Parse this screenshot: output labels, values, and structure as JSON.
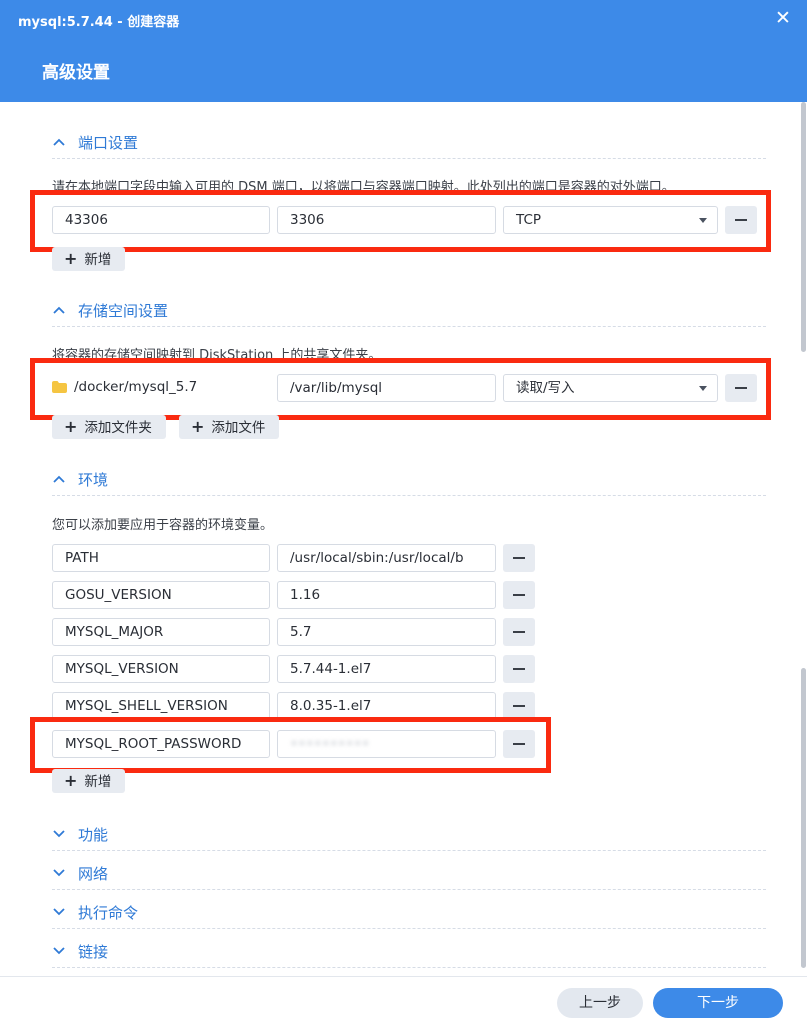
{
  "window": {
    "title": "mysql:5.7.44 - 创建容器",
    "page_title": "高级设置"
  },
  "sections": {
    "ports": {
      "title": "端口设置",
      "expanded": true,
      "description": "请在本地端口字段中输入可用的 DSM 端口，以将端口与容器端口映射。此处列出的端口是容器的对外端口。",
      "row": {
        "local_port": "43306",
        "container_port": "3306",
        "protocol": "TCP"
      },
      "add_label": "新增"
    },
    "storage": {
      "title": "存储空间设置",
      "expanded": true,
      "description": "将容器的存储空间映射到 DiskStation 上的共享文件夹。",
      "row": {
        "folder": "/docker/mysql_5.7",
        "mount_path": "/var/lib/mysql",
        "permission": "读取/写入"
      },
      "add_folder_label": "添加文件夹",
      "add_file_label": "添加文件"
    },
    "environment": {
      "title": "环境",
      "expanded": true,
      "description": "您可以添加要应用于容器的环境变量。",
      "rows": [
        {
          "key": "PATH",
          "value": "/usr/local/sbin:/usr/local/b"
        },
        {
          "key": "GOSU_VERSION",
          "value": "1.16"
        },
        {
          "key": "MYSQL_MAJOR",
          "value": "5.7"
        },
        {
          "key": "MYSQL_VERSION",
          "value": "5.7.44-1.el7"
        },
        {
          "key": "MYSQL_SHELL_VERSION",
          "value": "8.0.35-1.el7"
        },
        {
          "key": "MYSQL_ROOT_PASSWORD",
          "value": "••••••••••"
        }
      ],
      "add_label": "新增"
    },
    "functions": {
      "title": "功能",
      "expanded": false
    },
    "network": {
      "title": "网络",
      "expanded": false
    },
    "command": {
      "title": "执行命令",
      "expanded": false
    },
    "links": {
      "title": "链接",
      "expanded": false
    }
  },
  "footer": {
    "prev_label": "上一步",
    "next_label": "下一步"
  },
  "colors": {
    "accent": "#3d8ae8",
    "section_title": "#2f7ad6",
    "highlight": "#fa2a10",
    "folder": "#f5c542"
  },
  "icons": {
    "close": "close-icon",
    "expanded": "chevron-up-icon",
    "collapsed": "chevron-down-icon",
    "folder": "folder-icon",
    "remove": "minus-icon",
    "add": "plus-icon",
    "dropdown": "caret-down-icon"
  }
}
